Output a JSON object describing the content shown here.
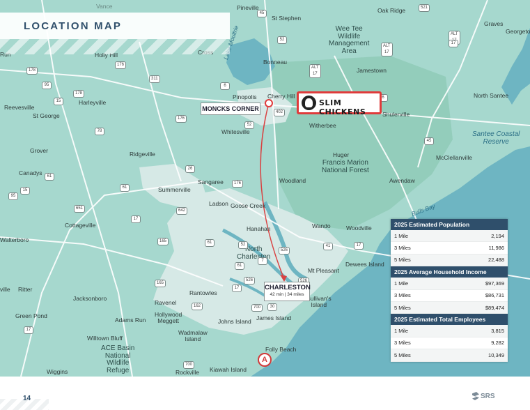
{
  "page": {
    "title": "LOCATION MAP",
    "page_number": "14",
    "brand_footer": "SRS"
  },
  "site": {
    "brand": "SLIM CHICKENS",
    "nearby_city": "MONCKS CORNER",
    "marker": "A"
  },
  "destination": {
    "city": "CHARLESTON",
    "detail": "42 min | 34 miles"
  },
  "places": {
    "pineville": "Pineville",
    "st_stephen": "St Stephen",
    "oak_ridge": "Oak Ridge",
    "vance": "Vance",
    "wee_tee": "Wee Tee\nWildlife\nManagement\nArea",
    "graves": "Graves",
    "georgetown": "Georgeto",
    "cross": "Cross",
    "holly_hill": "Holly Hill",
    "run": "Run",
    "lake_moultrie": "Lake Moultrie",
    "bonneau": "Bonneau",
    "jamestown": "Jamestown",
    "pinopolis": "Pinopolis",
    "cherry_hill": "Cherry Hill",
    "north_santee": "North Santee",
    "reevesville": "Reevesville",
    "harleyville": "Harleyville",
    "st_george": "St George",
    "whitesville": "Whitesville",
    "witherbee": "Witherbee",
    "shulerville": "Shulerville",
    "santee_coastal": "Santee Coastal\nReserve",
    "grover": "Grover",
    "ridgeville": "Ridgeville",
    "huger": "Huger",
    "francis_marion": "Francis Marion\nNational Forest",
    "mcclellanville": "McClellanville",
    "canadys": "Canadys",
    "sangaree": "Sangaree",
    "summerville": "Summerville",
    "woodland": "Woodland",
    "awendaw": "Awendaw",
    "bulls_bay": "Bulls Bay",
    "ladson": "Ladson",
    "goose_creek": "Goose Creek",
    "cottageville": "Cottageville",
    "wando": "Wando",
    "woodville": "Woodville",
    "hanahan": "Hanahan",
    "walterboro": "Walterboro",
    "north_charleston": "North\nCharleston",
    "mt_pleasant": "Mt Pleasant",
    "dewees_island": "Dewees Island",
    "ritter": "Ritter",
    "rantowles": "Rantowles",
    "ville": "ville",
    "jacksonboro": "Jacksonboro",
    "ravenel": "Ravenel",
    "sullivans_island": "Sullivan's\nIsland",
    "green_pond": "Green Pond",
    "hollywood_meggett": "Hollywood\nMeggett",
    "johns_island": "Johns Island",
    "james_island": "James Island",
    "adams_run": "Adams Run",
    "wadmalaw_island": "Wadmalaw\nIsland",
    "willtown_bluff": "Willtown Bluff",
    "ace_basin": "ACE Basin\nNational\nWildlife\nRefuge",
    "folly_beach": "Folly Beach",
    "wiggins": "Wiggins",
    "rockville": "Rockville",
    "kiawah_island": "Kiawah Island"
  },
  "routes": {
    "r45a": "45",
    "r6": "6",
    "r52a": "52",
    "r17a_a": "ALT\n17",
    "r17a_b": "17",
    "r521": "521",
    "r176a": "176",
    "r178a": "178",
    "r311": "311",
    "r95a": "95",
    "r178b": "178",
    "r15a": "15",
    "r6b": "6",
    "r17alt_c": "ALT\n17",
    "r402": "402",
    "r176b": "176",
    "r52b": "52",
    "r78": "78",
    "r45b": "45",
    "r26a": "26",
    "r61a": "61",
    "r15b": "15",
    "r95b": "95",
    "r61b": "61",
    "r176c": "176",
    "r651": "651",
    "r642": "642",
    "r17alt_d": "ALT\n17",
    "r165a": "165",
    "r61c": "61",
    "r52c": "52",
    "r17b": "17",
    "r41": "41",
    "r526a": "526",
    "r7": "7",
    "r526b": "526",
    "r526c": "526",
    "r61d": "61",
    "r17c": "17",
    "r165b": "165",
    "r162": "162",
    "r700a": "700",
    "r30": "30",
    "r17d": "17",
    "r700b": "700",
    "r17e": "17"
  },
  "stats": {
    "sections": [
      {
        "title": "2025 Estimated Population",
        "rows": [
          {
            "label": "1 Mile",
            "value": "2,194"
          },
          {
            "label": "3 Miles",
            "value": "11,986"
          },
          {
            "label": "5 Miles",
            "value": "22,488"
          }
        ]
      },
      {
        "title": "2025 Average Household Income",
        "rows": [
          {
            "label": "1 Mile",
            "value": "$97,369"
          },
          {
            "label": "3 Miles",
            "value": "$86,731"
          },
          {
            "label": "5 Miles",
            "value": "$89,474"
          }
        ]
      },
      {
        "title": "2025 Estimated Total Employees",
        "rows": [
          {
            "label": "1 Mile",
            "value": "3,815"
          },
          {
            "label": "3 Miles",
            "value": "9,282"
          },
          {
            "label": "5 Miles",
            "value": "10,349"
          }
        ]
      }
    ]
  },
  "colors": {
    "land": "#a6d8ce",
    "water": "#6eb5c2",
    "urban": "#d6e9e6",
    "forest": "#93cdbb",
    "accent_red": "#e03b3b",
    "navy": "#2f4f6b"
  }
}
